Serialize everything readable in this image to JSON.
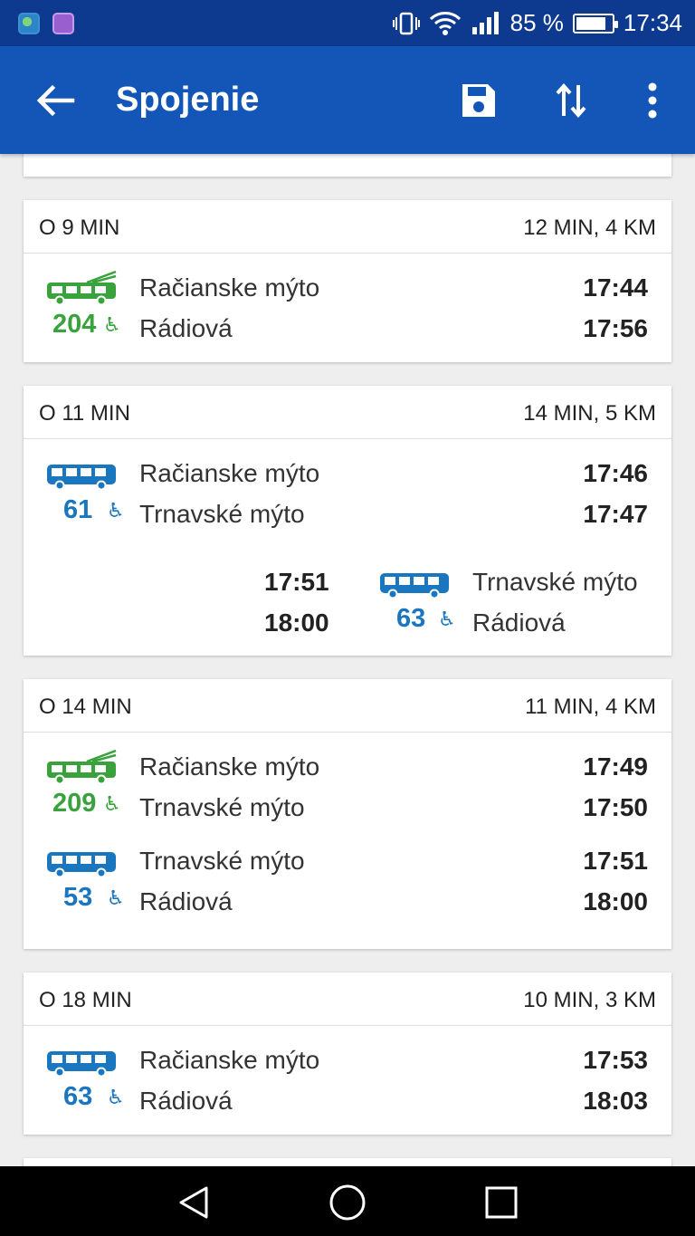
{
  "status": {
    "battery": "85 %",
    "time": "17:34",
    "battery_level": 0.85
  },
  "header": {
    "title": "Spojenie"
  },
  "icons": {
    "back": "arrow-back-icon",
    "save": "save-icon",
    "swap": "swap-vertical-icon",
    "more": "more-vert-icon"
  },
  "colors": {
    "appbar": "#1456b8",
    "statusbar": "#0d3a8f",
    "trolleybus": "#3aa23c",
    "bus": "#1a76bf"
  },
  "connections": [
    {
      "departure": "O  9 MIN",
      "duration": "12 MIN,   4 KM",
      "legs": [
        {
          "line": "204",
          "vehicle": "trolleybus",
          "from": "Račianske mýto",
          "to": "Rádiová",
          "dep_time": "17:44",
          "arr_time": "17:56"
        }
      ]
    },
    {
      "departure": "O  11 MIN",
      "duration": "14 MIN,   5 KM",
      "legs": [
        {
          "line": "61",
          "vehicle": "bus",
          "from": "Račianske mýto",
          "to": "Trnavské mýto",
          "dep_time": "17:46",
          "arr_time": "17:47"
        },
        {
          "line": "63",
          "vehicle": "bus",
          "from": "Trnavské mýto",
          "to": "Rádiová",
          "dep_time": "17:51",
          "arr_time": "18:00"
        }
      ]
    },
    {
      "departure": "O  14 MIN",
      "duration": "11 MIN,   4 KM",
      "legs": [
        {
          "line": "209",
          "vehicle": "trolleybus",
          "from": "Račianske mýto",
          "to": "Trnavské mýto",
          "dep_time": "17:49",
          "arr_time": "17:50"
        },
        {
          "line": "53",
          "vehicle": "bus",
          "from": "Trnavské mýto",
          "to": "Rádiová",
          "dep_time": "17:51",
          "arr_time": "18:00"
        }
      ]
    },
    {
      "departure": "O  18 MIN",
      "duration": "10 MIN,   3 KM",
      "legs": [
        {
          "line": "63",
          "vehicle": "bus",
          "from": "Račianske mýto",
          "to": "Rádiová",
          "dep_time": "17:53",
          "arr_time": "18:03"
        }
      ]
    }
  ]
}
